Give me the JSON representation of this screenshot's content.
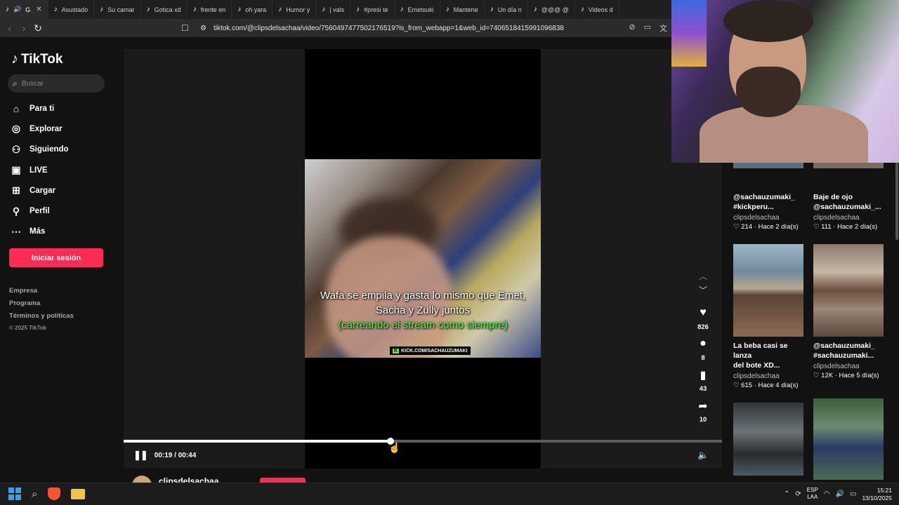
{
  "browser": {
    "tabs": [
      {
        "label": "G",
        "active": true
      },
      {
        "label": "Asustado"
      },
      {
        "label": "Su camar"
      },
      {
        "label": "Gotica xd"
      },
      {
        "label": "frente en"
      },
      {
        "label": "oh yara"
      },
      {
        "label": "Humor y"
      },
      {
        "label": "| vals"
      },
      {
        "label": "#presi te"
      },
      {
        "label": "Emetsuki"
      },
      {
        "label": "Mantene"
      },
      {
        "label": "Un día n"
      },
      {
        "label": "@@@ @"
      },
      {
        "label": "Videos d"
      }
    ],
    "url": "tiktok.com/@clipsdelsachaa/video/7560497477502176519?is_from_webapp=1&web_id=7406518415991096838"
  },
  "sidebar": {
    "logo": "TikTok",
    "search_placeholder": "Buscar",
    "nav": [
      {
        "label": "Para ti",
        "icon": "home-icon"
      },
      {
        "label": "Explorar",
        "icon": "compass-icon"
      },
      {
        "label": "Siguiendo",
        "icon": "following-icon"
      },
      {
        "label": "LIVE",
        "icon": "live-icon"
      },
      {
        "label": "Cargar",
        "icon": "upload-icon"
      },
      {
        "label": "Perfil",
        "icon": "profile-icon"
      },
      {
        "label": "Más",
        "icon": "more-icon"
      }
    ],
    "login_label": "Iniciar sesión",
    "footer": [
      "Empresa",
      "Programa",
      "Términos y políticas"
    ],
    "copyright": "© 2025 TikTok"
  },
  "video": {
    "subtitle_line1": "Wafa se empila y gasta lo mismo que Emet,",
    "subtitle_line2": "Sacha y Zully juntos",
    "subtitle_green": "(carreando el stream como siempre)",
    "watermark": "KICK.COM/SACHAUZUMAKI",
    "current_time": "00:19",
    "duration": "00:44",
    "progress": 0.446,
    "author": "clipsdelsachaa"
  },
  "actions": {
    "likes": "826",
    "comments": "8",
    "saves": "43",
    "shares": "10"
  },
  "recommended": [
    {
      "title_l1": "@sachauzumaki_",
      "title_l2": "#kickperu...",
      "author": "clipsdelsachaa",
      "likes": "214",
      "date": "Hace 2 día(s)"
    },
    {
      "title_l1": "Baje de ojo",
      "title_l2": "@sachauzumaki_...",
      "author": "clipsdelsachaa",
      "likes": "111",
      "date": "Hace 2 día(s)"
    },
    {
      "title_l1": "La beba casi se lanza",
      "title_l2": "del bote XD...",
      "author": "clipsdelsachaa",
      "likes": "615",
      "date": "Hace 4 día(s)"
    },
    {
      "title_l1": "@sachauzumaki_",
      "title_l2": "#sachauzumaki...",
      "author": "clipsdelsachaa",
      "likes": "12K",
      "date": "Hace 5 día(s)"
    }
  ],
  "taskbar": {
    "lang_line1": "ESP",
    "lang_line2": "LAA",
    "time": "15:21",
    "date": "13/10/2025"
  },
  "colors": {
    "accent": "#fe2c55",
    "subtitle_green": "#3dff3d"
  }
}
